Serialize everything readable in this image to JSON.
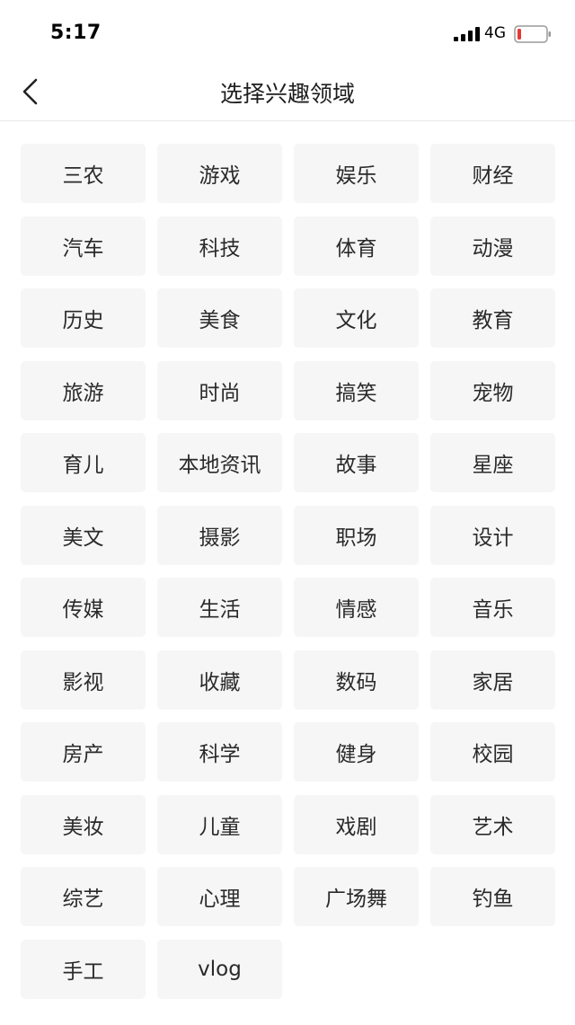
{
  "status_bar": {
    "time": "5:17",
    "network": "4G",
    "battery_color": "#e53935"
  },
  "nav": {
    "back_icon": "chevron-left-icon",
    "title": "选择兴趣领域"
  },
  "interests": [
    "三农",
    "游戏",
    "娱乐",
    "财经",
    "汽车",
    "科技",
    "体育",
    "动漫",
    "历史",
    "美食",
    "文化",
    "教育",
    "旅游",
    "时尚",
    "搞笑",
    "宠物",
    "育儿",
    "本地资讯",
    "故事",
    "星座",
    "美文",
    "摄影",
    "职场",
    "设计",
    "传媒",
    "生活",
    "情感",
    "音乐",
    "影视",
    "收藏",
    "数码",
    "家居",
    "房产",
    "科学",
    "健身",
    "校园",
    "美妆",
    "儿童",
    "戏剧",
    "艺术",
    "综艺",
    "心理",
    "广场舞",
    "钓鱼",
    "手工",
    "vlog"
  ]
}
